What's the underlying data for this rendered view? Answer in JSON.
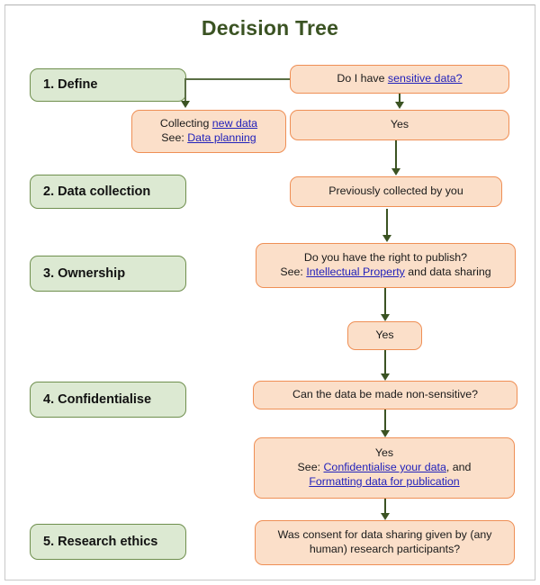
{
  "page": {
    "title": "Decision Tree",
    "title_color": "#3b5323",
    "node_fill": "#fbdfc9",
    "node_border": "#ef8f55",
    "stage_fill": "#dce9d2",
    "stage_border": "#6f8f4e",
    "link_color": "#2222bb",
    "arrow_color": "#3b5323"
  },
  "stages": [
    {
      "label": "1. Define"
    },
    {
      "label": "2. Data collection"
    },
    {
      "label": "3. Ownership"
    },
    {
      "label": "4. Confidentialise"
    },
    {
      "label": "5. Research ethics"
    }
  ],
  "nodes": {
    "sensitive_question": {
      "pre": "Do I have ",
      "link": "sensitive data?",
      "post": ""
    },
    "collecting_new_data": {
      "line1_pre": "Collecting ",
      "line1_link": "new data",
      "line2_pre": "See: ",
      "line2_link": "Data planning"
    },
    "yes_1": {
      "text": "Yes"
    },
    "previously_collected": {
      "text": "Previously collected by you"
    },
    "ownership_question": {
      "line1": "Do you have the right to publish?",
      "line2_pre": "See: ",
      "line2_link": "Intellectual Property",
      "line2_post": " and data sharing"
    },
    "yes_2": {
      "text": "Yes"
    },
    "non_sensitive_question": {
      "text": "Can the data be made non-sensitive?"
    },
    "yes_3": {
      "line1": "Yes",
      "line2_pre": "See: ",
      "line2_link": "Confidentialise your data",
      "line2_post": ", and",
      "line3_link": "Formatting data for publication"
    },
    "consent_question": {
      "line1": "Was consent for data sharing given by (any",
      "line2": "human) research participants?"
    }
  }
}
